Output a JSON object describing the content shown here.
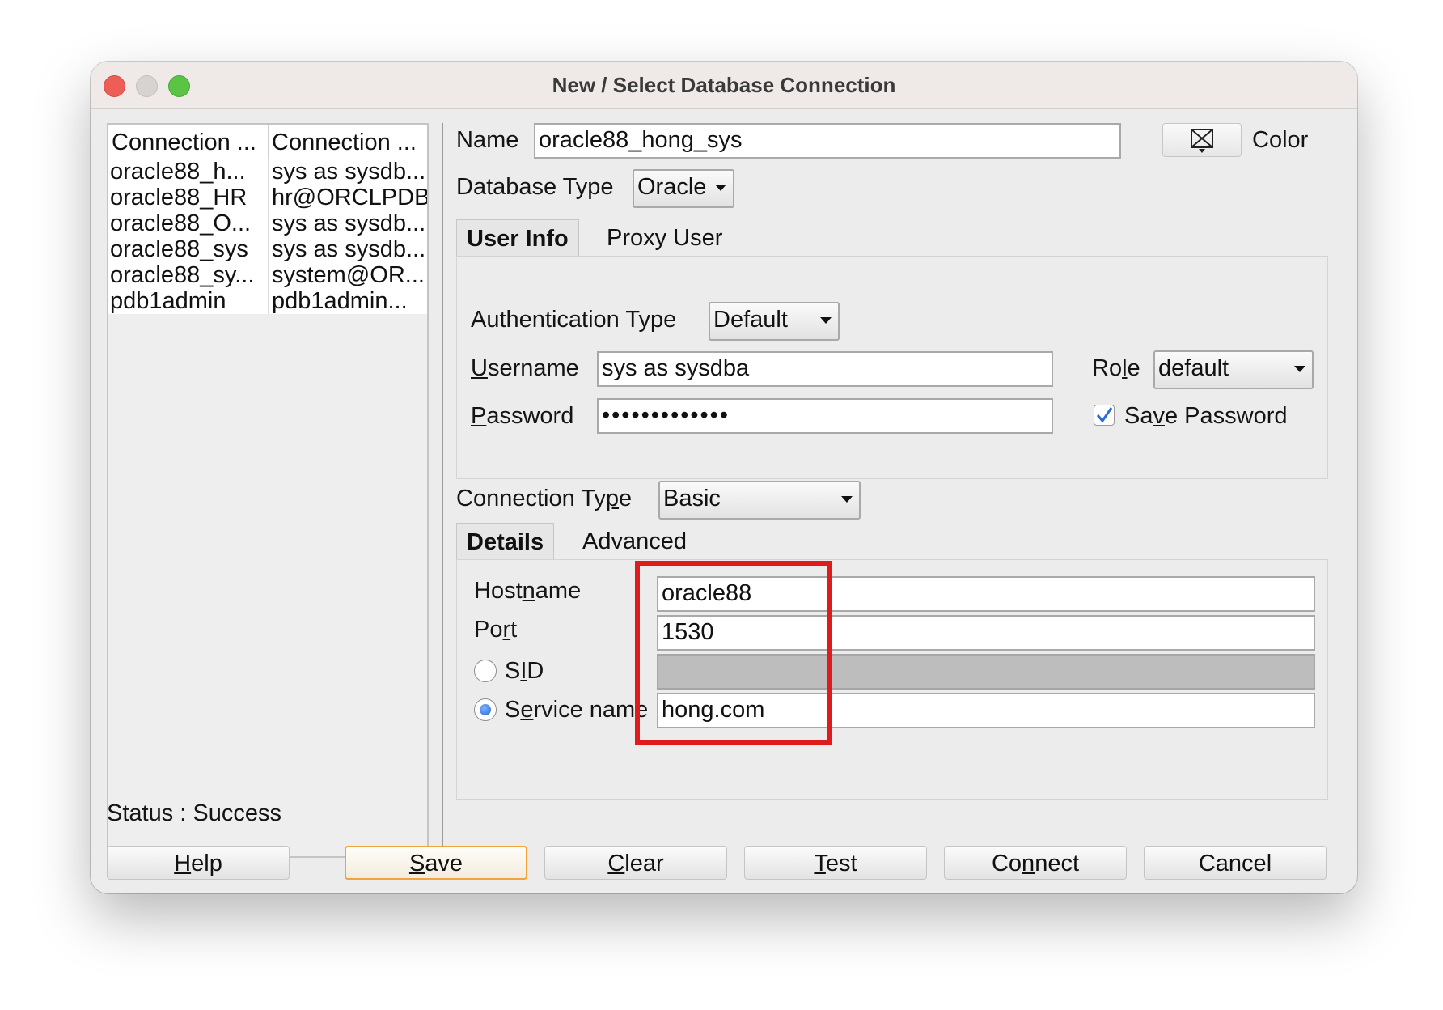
{
  "window": {
    "title": "New / Select Database Connection"
  },
  "connection_list": {
    "headers": [
      "Connection ...",
      "Connection ..."
    ],
    "rows": [
      {
        "name": "oracle88_h...",
        "details": "sys as sysdb..."
      },
      {
        "name": "oracle88_HR",
        "details": "hr@ORCLPDB"
      },
      {
        "name": "oracle88_O...",
        "details": "sys as sysdb..."
      },
      {
        "name": "oracle88_sys",
        "details": "sys as sysdb..."
      },
      {
        "name": "oracle88_sy...",
        "details": "system@OR..."
      },
      {
        "name": "pdb1admin",
        "details": "pdb1admin..."
      }
    ]
  },
  "form": {
    "name_label": "Name",
    "name_value": "oracle88_hong_sys",
    "color_label": "Color",
    "db_type_label": "Database Type",
    "db_type_value": "Oracle",
    "tabs": [
      "User Info",
      "Proxy User"
    ],
    "auth_type_label": "Authentication Type",
    "auth_type_value": "Default",
    "username_label_prefix": "U",
    "username_label_rest": "sername",
    "username_value": "sys as sysdba",
    "password_label_prefix": "P",
    "password_label_rest": "assword",
    "password_value": "•••••••••••••",
    "role_label_pre": "Ro",
    "role_label_u": "l",
    "role_label_post": "e",
    "role_value": "default",
    "save_password_pre": "Sa",
    "save_password_u": "v",
    "save_password_post": "e Password",
    "save_password_checked": true,
    "conn_type_label_pre": "Connection Ty",
    "conn_type_label_u": "p",
    "conn_type_label_post": "e",
    "conn_type_value": "Basic",
    "detail_tabs": [
      "Details",
      "Advanced"
    ],
    "hostname_pre": "Host",
    "hostname_u": "n",
    "hostname_post": "ame",
    "hostname_value": "oracle88",
    "port_pre": "Po",
    "port_u": "r",
    "port_post": "t",
    "port_value": "1530",
    "sid_pre": "S",
    "sid_u": "I",
    "sid_post": "D",
    "sid_value": "",
    "service_pre": "S",
    "service_u": "e",
    "service_post": "rvice name",
    "service_value": "hong.com",
    "selected_radio": "service_name"
  },
  "status": {
    "text": "Status : Success"
  },
  "buttons": {
    "help_u": "H",
    "help_rest": "elp",
    "save_u": "S",
    "save_rest": "ave",
    "clear_u": "C",
    "clear_rest": "lear",
    "test_u": "T",
    "test_rest": "est",
    "connect_pre": "Co",
    "connect_u": "n",
    "connect_post": "nect",
    "cancel": "Cancel"
  },
  "colors": {
    "highlight": "#e01b1b",
    "default_button_border": "#f0a43b",
    "checkbox_check": "#2a6bd6"
  }
}
